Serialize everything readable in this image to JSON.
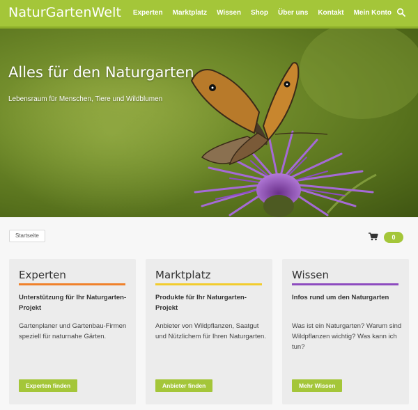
{
  "header": {
    "logo": "NaturGartenWelt",
    "nav": [
      "Experten",
      "Marktplatz",
      "Wissen",
      "Shop",
      "Über uns",
      "Kontakt",
      "Mein Konto"
    ],
    "brand_color": "#a4c639"
  },
  "hero": {
    "title": "Alles für den Naturgarten",
    "subtitle": "Lebensraum für Menschen, Tiere und Wildblumen"
  },
  "breadcrumb": "Startseite",
  "cart": {
    "count": "0"
  },
  "cards": [
    {
      "title": "Experten",
      "accent": "#f0812a",
      "subtitle": "Unterstützung für Ihr Naturgarten-Projekt",
      "text": "Gartenplaner und Gartenbau-Firmen speziell für naturnahe Gärten.",
      "button": "Experten finden"
    },
    {
      "title": "Marktplatz",
      "accent": "#f2cc2d",
      "subtitle": "Produkte für Ihr Naturgarten-Projekt",
      "text": "Anbieter von Wildpflanzen, Saatgut und Nützlichem für Ihren Naturgarten.",
      "button": "Anbieter finden"
    },
    {
      "title": "Wissen",
      "accent": "#8d4bbf",
      "subtitle": "Infos rund um den Naturgarten",
      "text": "Was ist ein Naturgarten? Warum sind Wildpflanzen wichtig? Was kann ich tun?",
      "button": "Mehr Wissen"
    }
  ]
}
